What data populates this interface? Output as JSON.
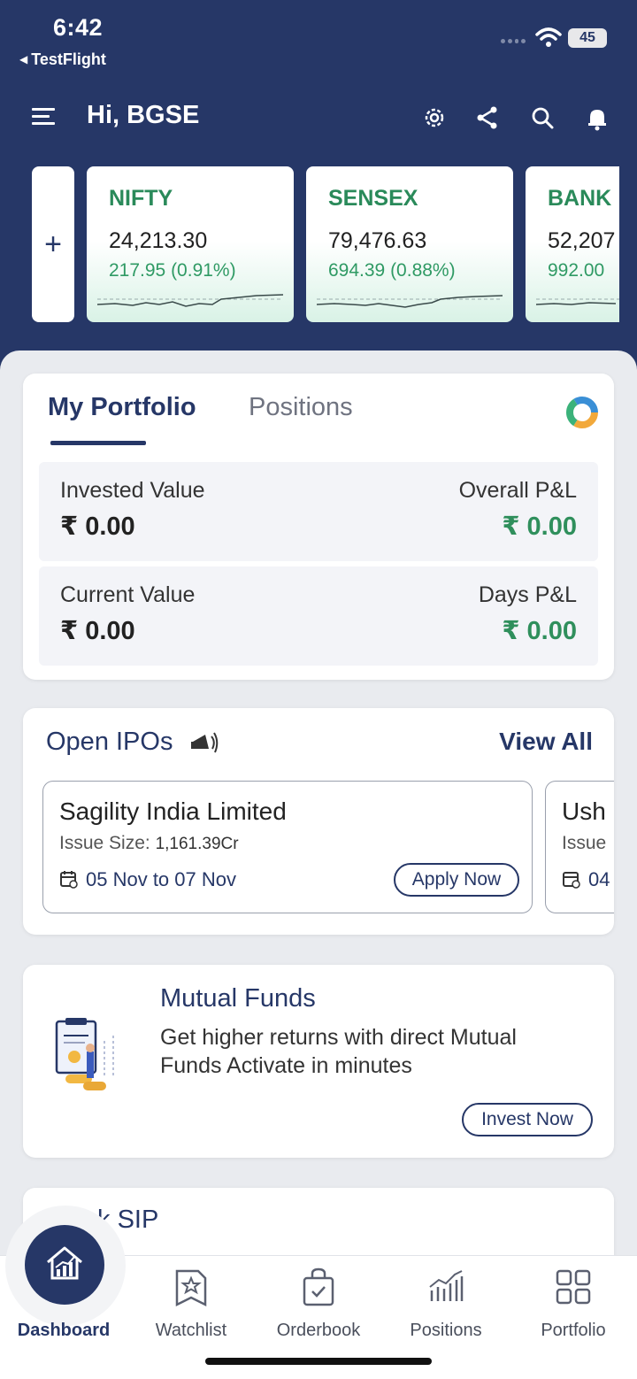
{
  "status_bar": {
    "time": "6:42",
    "back_app": "TestFlight",
    "battery": "45"
  },
  "header": {
    "greeting": "Hi, BGSE",
    "icons": [
      "menu-icon",
      "settings-icon",
      "share-icon",
      "search-icon",
      "bell-icon"
    ]
  },
  "tickers": [
    {
      "name": "NIFTY",
      "value": "24,213.30",
      "change": "217.95 (0.91%)"
    },
    {
      "name": "SENSEX",
      "value": "79,476.63",
      "change": "694.39 (0.88%)"
    },
    {
      "name": "BANK",
      "value": "52,207",
      "change": "992.00"
    }
  ],
  "add_ticker_label": "+",
  "portfolio": {
    "tabs": [
      "My Portfolio",
      "Positions"
    ],
    "invested_label": "Invested Value",
    "invested_value": "₹ 0.00",
    "overall_label": "Overall P&L",
    "overall_value": "₹ 0.00",
    "current_label": "Current Value",
    "current_value": "₹ 0.00",
    "days_label": "Days P&L",
    "days_value": "₹ 0.00"
  },
  "ipos": {
    "title": "Open IPOs",
    "view_all": "View All",
    "items": [
      {
        "name": "Sagility India Limited",
        "size_label": "Issue Size:",
        "size_value": "1,161.39Cr",
        "dates": "05 Nov to 07 Nov",
        "apply": "Apply Now"
      },
      {
        "name": "Ush",
        "size_label": "Issue",
        "size_value": "",
        "dates": "04",
        "apply": ""
      }
    ]
  },
  "mutual_funds": {
    "title": "Mutual Funds",
    "description": "Get higher returns with direct Mutual Funds Activate in minutes",
    "cta": "Invest Now"
  },
  "stock_sip": {
    "title": "Stock SIP"
  },
  "bottom_nav": [
    "Dashboard",
    "Watchlist",
    "Orderbook",
    "Positions",
    "Portfolio"
  ],
  "colors": {
    "primary": "#263767",
    "green": "#2f8f5c",
    "ticker_green": "#2a8a5a"
  }
}
